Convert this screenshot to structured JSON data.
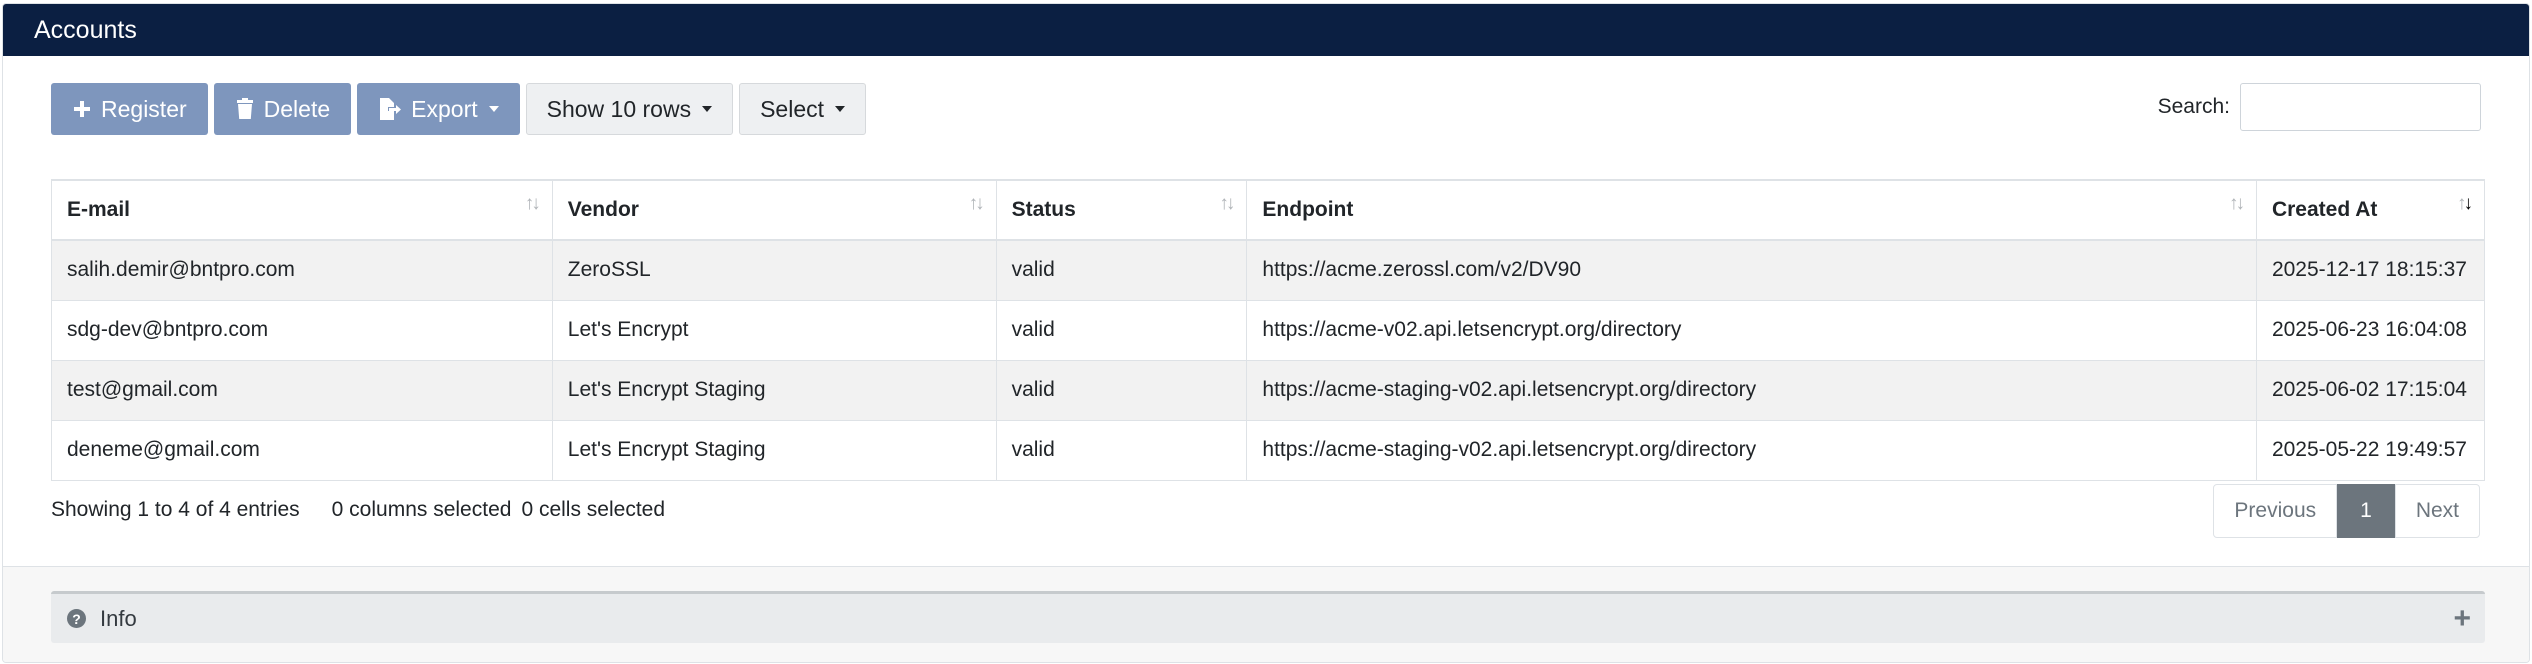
{
  "panel": {
    "title": "Accounts"
  },
  "toolbar": {
    "register_label": "Register",
    "delete_label": "Delete",
    "export_label": "Export",
    "show_rows_label": "Show 10 rows",
    "select_label": "Select"
  },
  "search": {
    "label": "Search:",
    "value": ""
  },
  "table": {
    "columns": [
      "E-mail",
      "Vendor",
      "Status",
      "Endpoint",
      "Created At"
    ],
    "rows": [
      [
        "salih.demir@bntpro.com",
        "ZeroSSL",
        "valid",
        "https://acme.zerossl.com/v2/DV90",
        "2025-12-17 18:15:37"
      ],
      [
        "sdg-dev@bntpro.com",
        "Let's Encrypt",
        "valid",
        "https://acme-v02.api.letsencrypt.org/directory",
        "2025-06-23 16:04:08"
      ],
      [
        "test@gmail.com",
        "Let's Encrypt Staging",
        "valid",
        "https://acme-staging-v02.api.letsencrypt.org/directory",
        "2025-06-02 17:15:04"
      ],
      [
        "deneme@gmail.com",
        "Let's Encrypt Staging",
        "valid",
        "https://acme-staging-v02.api.letsencrypt.org/directory",
        "2025-05-22 19:49:57"
      ]
    ],
    "sorted_column": "Created At",
    "sort_direction": "descending"
  },
  "status": {
    "showing": "Showing 1 to 4 of 4 entries",
    "columns_selected": "0 columns selected",
    "cells_selected": "0 cells selected"
  },
  "pagination": {
    "previous": "Previous",
    "current": "1",
    "next": "Next"
  },
  "info": {
    "title": "Info"
  },
  "colors": {
    "header_bg": "#0b1f42",
    "primary_button": "#7e96bd",
    "active_page": "#6c757d"
  },
  "icons": {
    "register": "plus-icon",
    "delete": "trash-icon",
    "export": "file-export-icon",
    "info": "question-circle-icon",
    "expand": "plus-icon"
  }
}
